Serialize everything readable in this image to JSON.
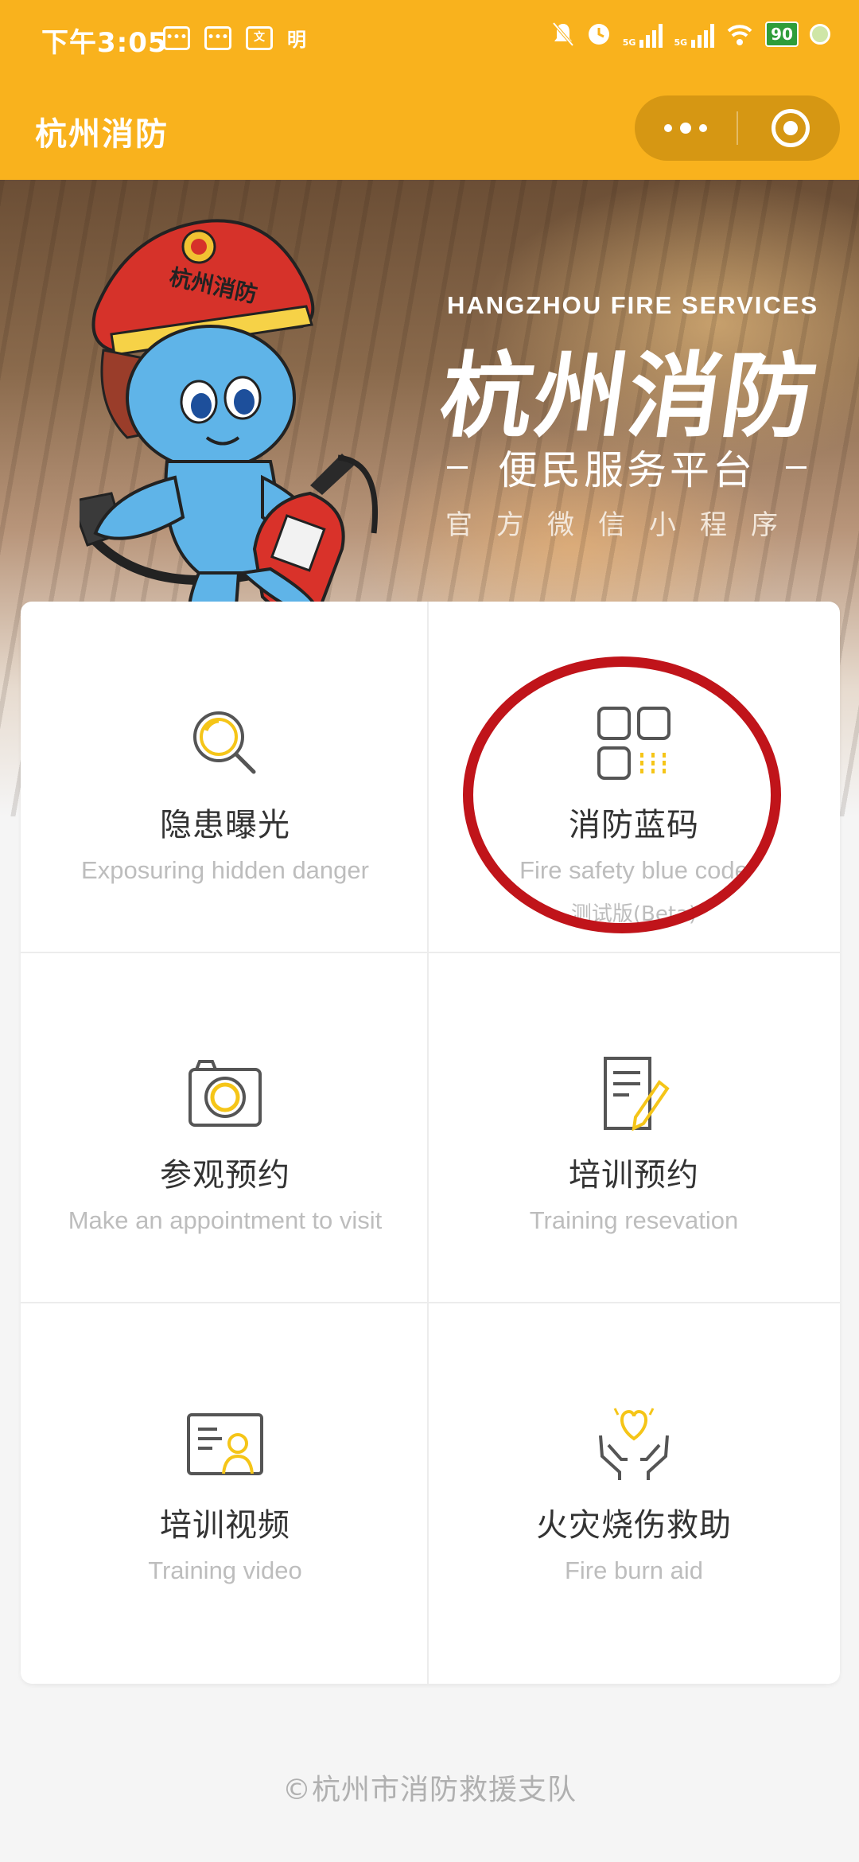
{
  "status_bar": {
    "time": "下午3:05",
    "left_icons": [
      "message-icon",
      "message-icon",
      "translate-icon"
    ],
    "left_text": "明",
    "right_icons": [
      "mute-icon",
      "alarm-icon",
      "signal-icon",
      "signal-icon",
      "wifi-icon",
      "battery-icon",
      "leaf-icon"
    ],
    "signal_label": "5G",
    "battery_level": "90"
  },
  "nav": {
    "title": "杭州消防",
    "more_icon": "more-dots-icon",
    "close_icon": "close-miniprogram-icon"
  },
  "banner": {
    "en_title": "HANGZHOU FIRE SERVICES",
    "cn_title": "杭州消防",
    "subtitle": "便民服务平台",
    "tagline": "官方微信小程序",
    "mascot_helmet_text": "杭州消防"
  },
  "grid": {
    "items": [
      {
        "title": "隐患曝光",
        "subtitle": "Exposuring hidden danger",
        "icon": "magnifier-icon"
      },
      {
        "title": "消防蓝码",
        "subtitle": "Fire safety blue code",
        "note": "测试版(Beta)",
        "icon": "qr-code-icon"
      },
      {
        "title": "参观预约",
        "subtitle": "Make an appointment to visit",
        "icon": "camera-icon"
      },
      {
        "title": "培训预约",
        "subtitle": "Training resevation",
        "icon": "document-pen-icon"
      },
      {
        "title": "培训视频",
        "subtitle": "Training video",
        "icon": "id-card-icon"
      },
      {
        "title": "火灾烧伤救助",
        "subtitle": "Fire burn aid",
        "icon": "hands-heart-icon"
      }
    ]
  },
  "colors": {
    "brand": "#f9b21d",
    "accent": "#f5c518",
    "annotation": "#c0141a"
  },
  "footer": {
    "text": "©杭州市消防救援支队"
  }
}
